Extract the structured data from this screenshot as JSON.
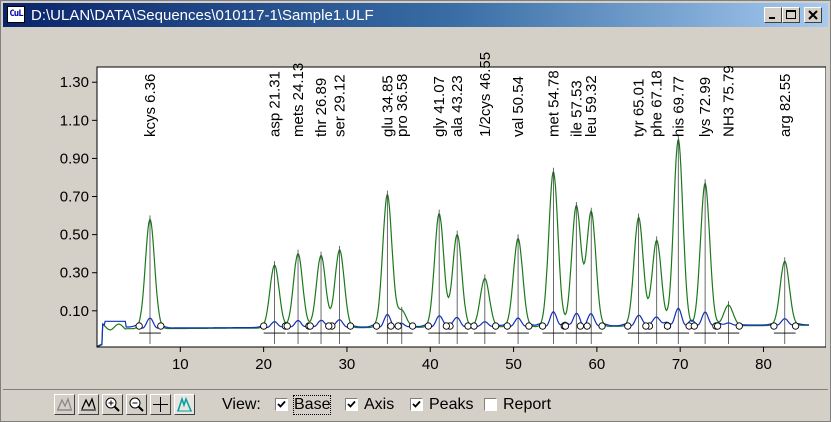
{
  "window": {
    "title": "D:\\ULAN\\DATA\\Sequences\\010117-1\\Sample1.ULF",
    "app_icon_text": "CuL",
    "buttons": [
      "minimize",
      "maximize",
      "close"
    ]
  },
  "chart_data": {
    "type": "line",
    "x_ticks": [
      "10",
      "20",
      "30",
      "40",
      "50",
      "60",
      "70",
      "80"
    ],
    "y_ticks": [
      "1.30",
      "1.10",
      "0.90",
      "0.70",
      "0.50",
      "0.30",
      "0.10"
    ],
    "xlim": [
      0,
      87.5
    ],
    "ylim": [
      -0.09,
      1.38
    ],
    "colors": {
      "raw": "#1a7a1a",
      "baseline": "#1030c0"
    },
    "peaks": [
      {
        "label": "kcys 6.36",
        "x": 6.36,
        "h": 0.58
      },
      {
        "label": "asp 21.31",
        "x": 21.31,
        "h": 0.34
      },
      {
        "label": "mets 24.13",
        "x": 24.13,
        "h": 0.4
      },
      {
        "label": "thr 26.89",
        "x": 26.89,
        "h": 0.39
      },
      {
        "label": "ser 29.12",
        "x": 29.12,
        "h": 0.42
      },
      {
        "label": "glu 34.85",
        "x": 34.85,
        "h": 0.71
      },
      {
        "label": "pro 36.58",
        "x": 36.58,
        "h": 0.1
      },
      {
        "label": "gly 41.07",
        "x": 41.07,
        "h": 0.61
      },
      {
        "label": "ala 43.23",
        "x": 43.23,
        "h": 0.5
      },
      {
        "label": "1/2cys 46.55",
        "x": 46.55,
        "h": 0.27
      },
      {
        "label": "val 50.54",
        "x": 50.54,
        "h": 0.48
      },
      {
        "label": "met 54.78",
        "x": 54.78,
        "h": 0.83
      },
      {
        "label": "ile 57.53",
        "x": 57.53,
        "h": 0.65
      },
      {
        "label": "leu 59.32",
        "x": 59.32,
        "h": 0.62
      },
      {
        "label": "tyr 65.01",
        "x": 65.01,
        "h": 0.59
      },
      {
        "label": "phe 67.18",
        "x": 67.18,
        "h": 0.47
      },
      {
        "label": "his 69.77",
        "x": 69.77,
        "h": 1.0
      },
      {
        "label": "lys 72.99",
        "x": 72.99,
        "h": 0.77
      },
      {
        "label": "NH3 75.79",
        "x": 75.79,
        "h": 0.13
      },
      {
        "label": "arg 82.55",
        "x": 82.55,
        "h": 0.36
      }
    ]
  },
  "toolbar": {
    "view_label": "View:",
    "base_label": "Base",
    "axis_label": "Axis",
    "peaks_label": "Peaks",
    "report_label": "Report",
    "base_checked": true,
    "axis_checked": true,
    "peaks_checked": true,
    "report_checked": false
  }
}
